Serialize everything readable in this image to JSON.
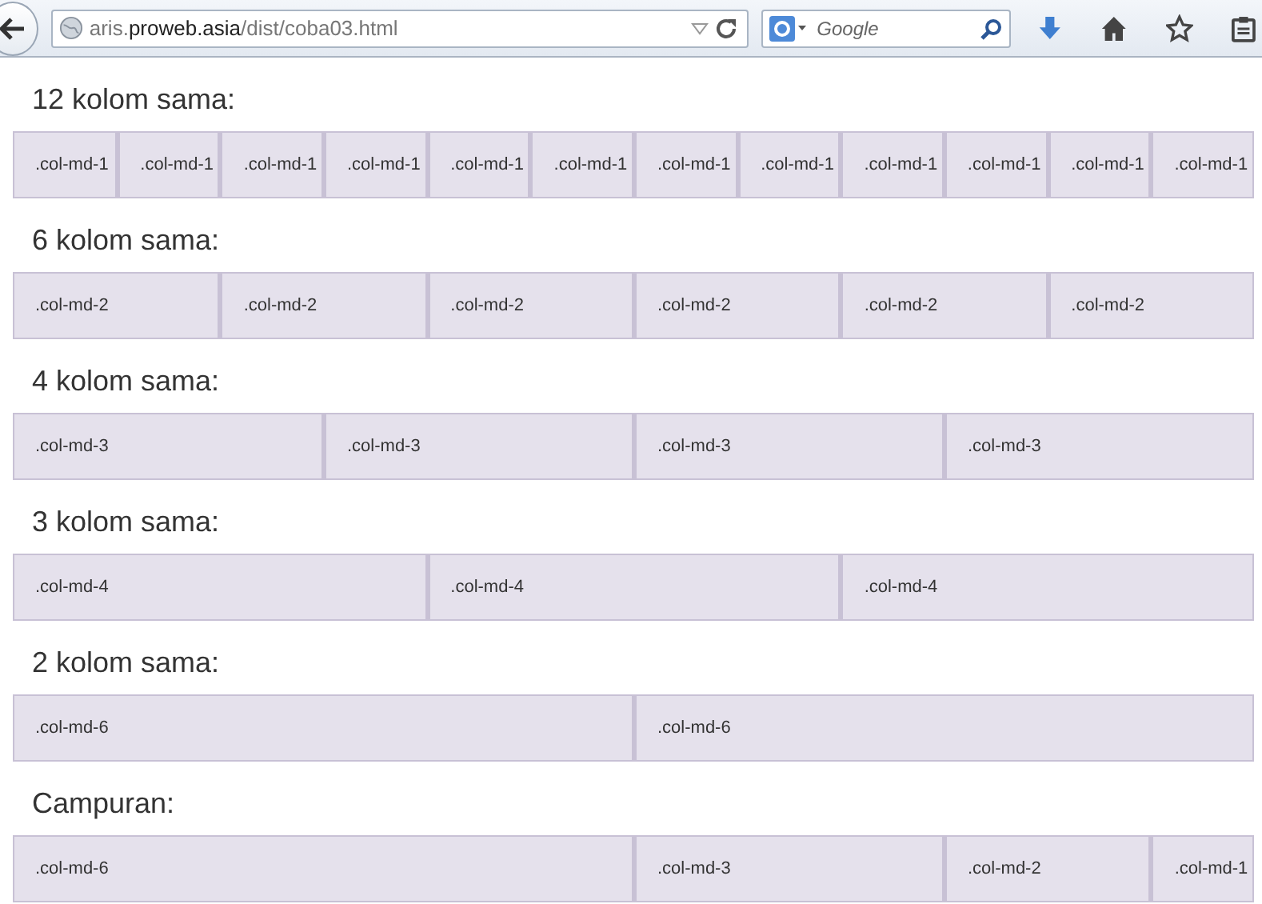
{
  "browser": {
    "url_host_prefix": "aris.",
    "url_domain": "proweb.asia",
    "url_path": "/dist/coba03.html",
    "search_placeholder": "Google"
  },
  "sections": [
    {
      "heading": "12 kolom sama:",
      "columns": [
        ".col-md-1",
        ".col-md-1",
        ".col-md-1",
        ".col-md-1",
        ".col-md-1",
        ".col-md-1",
        ".col-md-1",
        ".col-md-1",
        ".col-md-1",
        ".col-md-1",
        ".col-md-1",
        ".col-md-1"
      ]
    },
    {
      "heading": "6 kolom sama:",
      "columns": [
        ".col-md-2",
        ".col-md-2",
        ".col-md-2",
        ".col-md-2",
        ".col-md-2",
        ".col-md-2"
      ]
    },
    {
      "heading": "4 kolom sama:",
      "columns": [
        ".col-md-3",
        ".col-md-3",
        ".col-md-3",
        ".col-md-3"
      ]
    },
    {
      "heading": "3 kolom sama:",
      "columns": [
        ".col-md-4",
        ".col-md-4",
        ".col-md-4"
      ]
    },
    {
      "heading": "2 kolom sama:",
      "columns": [
        ".col-md-6",
        ".col-md-6"
      ]
    },
    {
      "heading": "Campuran:",
      "columns": [
        ".col-md-6",
        ".col-md-3",
        ".col-md-2",
        ".col-md-1"
      ]
    }
  ]
}
